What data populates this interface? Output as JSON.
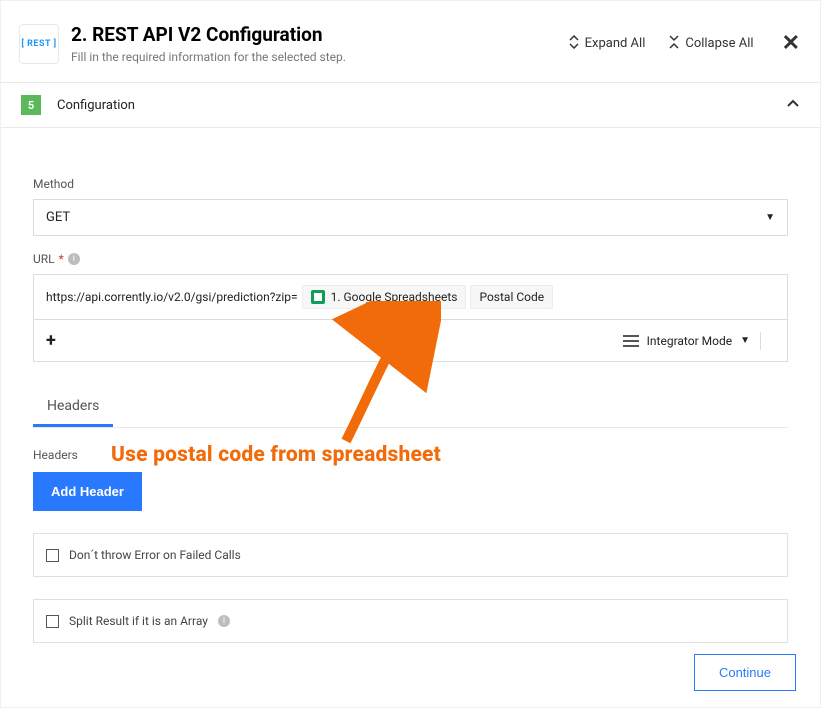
{
  "header": {
    "icon_label": "[ REST ]",
    "title": "2. REST API V2 Configuration",
    "subtitle": "Fill in the required information for the selected step.",
    "expand_label": "Expand All",
    "collapse_label": "Collapse All"
  },
  "section": {
    "number": "5",
    "title": "Configuration"
  },
  "method": {
    "label": "Method",
    "value": "GET"
  },
  "url": {
    "label": "URL",
    "required_mark": "*",
    "value_prefix": "https://api.corrently.io/v2.0/gsi/prediction?zip=",
    "chip_source": "1. Google Spreadsheets",
    "chip_field": "Postal Code",
    "mode_label": "Integrator Mode"
  },
  "tabs": {
    "headers": "Headers"
  },
  "headers": {
    "label": "Headers",
    "add_button": "Add Header"
  },
  "options": {
    "no_throw": "Don´t throw Error on Failed Calls",
    "split_array": "Split Result if it is an Array"
  },
  "footer": {
    "continue": "Continue"
  },
  "annotation": {
    "text": "Use postal code from spreadsheet"
  }
}
